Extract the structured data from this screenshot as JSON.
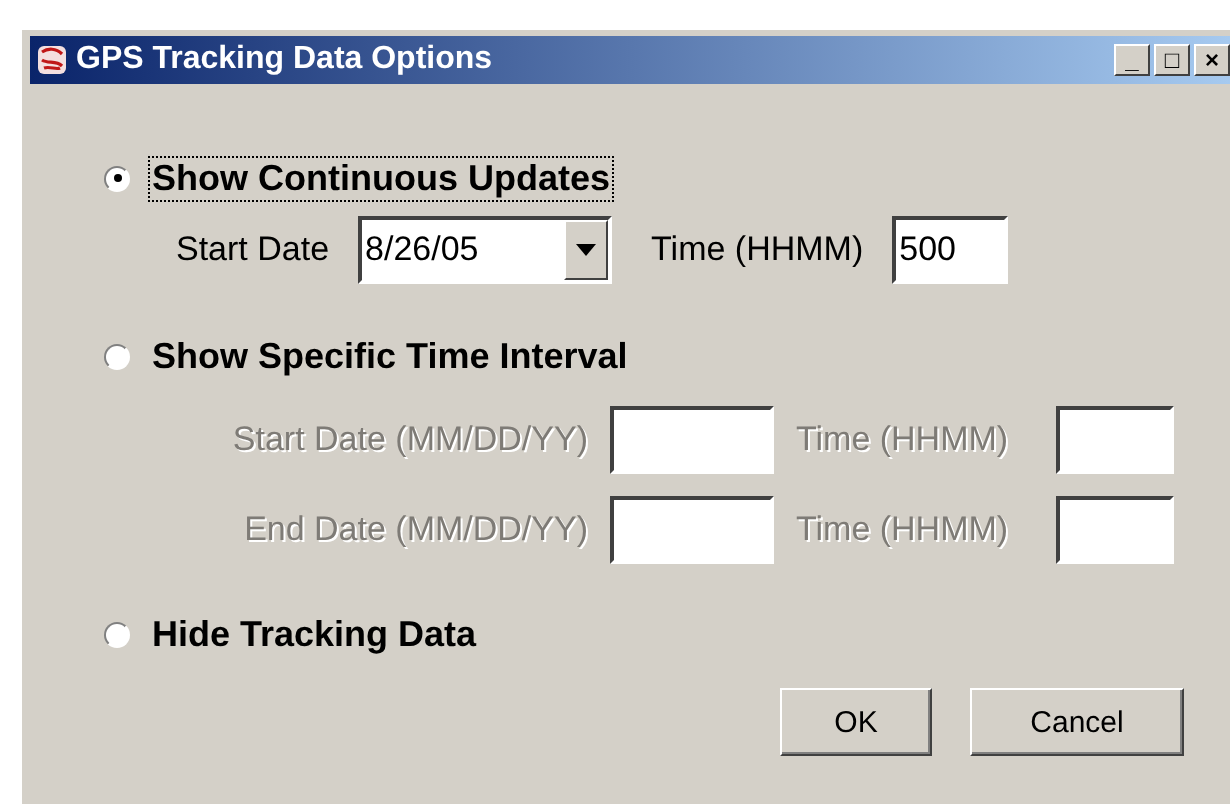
{
  "window": {
    "title": "GPS Tracking Data Options",
    "controls": [
      "_",
      "□",
      "×"
    ]
  },
  "options": [
    {
      "label": "Show Continuous Updates",
      "selected": true,
      "focused": true,
      "rows": [
        {
          "disabled": false,
          "date_label": "Start Date",
          "date_field": {
            "kind": "combo",
            "value": "8/26/05"
          },
          "time_label": "Time (HHMM)",
          "time_field": {
            "value": "500"
          }
        }
      ]
    },
    {
      "label": "Show Specific Time Interval",
      "selected": false,
      "focused": false,
      "rows": [
        {
          "disabled": true,
          "date_label": "Start Date (MM/DD/YY)",
          "date_field": {
            "kind": "text"
          },
          "time_label": "Time (HHMM)",
          "time_field": {}
        },
        {
          "disabled": true,
          "date_label": "End Date (MM/DD/YY)",
          "date_field": {
            "kind": "text"
          },
          "time_label": "Time (HHMM)",
          "time_field": {}
        }
      ]
    },
    {
      "label": "Hide Tracking Data",
      "selected": false,
      "focused": false
    }
  ],
  "buttons": [
    "OK",
    "Cancel"
  ]
}
